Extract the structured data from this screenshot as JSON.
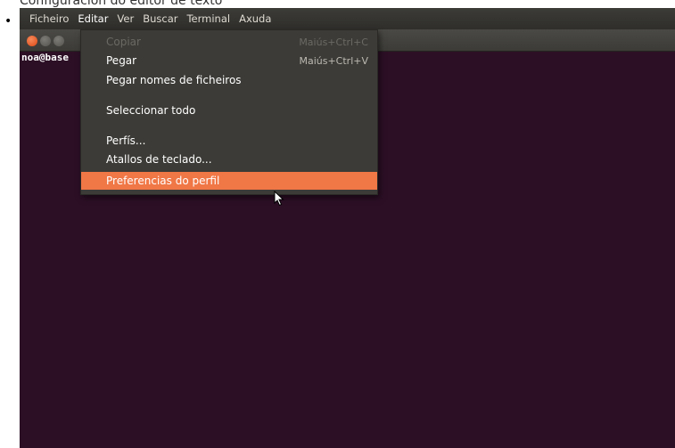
{
  "caption": "Configuración do editor de texto",
  "menubar": {
    "items": [
      "Ficheiro",
      "Editar",
      "Ver",
      "Buscar",
      "Terminal",
      "Axuda"
    ],
    "active": "Editar"
  },
  "terminal": {
    "prompt": "noa@base"
  },
  "edit_menu": {
    "items": [
      {
        "label": "Copiar",
        "shortcut": "Maiús+Ctrl+C",
        "enabled": false
      },
      {
        "label": "Pegar",
        "shortcut": "Maiús+Ctrl+V",
        "enabled": true
      },
      {
        "label": "Pegar nomes de ficheiros",
        "shortcut": "",
        "enabled": true
      },
      {
        "label": "Seleccionar todo",
        "shortcut": "",
        "enabled": true
      },
      {
        "label": "Perfís...",
        "shortcut": "",
        "enabled": true
      },
      {
        "label": "Atallos de teclado...",
        "shortcut": "",
        "enabled": true
      },
      {
        "label": "Preferencias do perfil",
        "shortcut": "",
        "enabled": true,
        "highlighted": true
      }
    ]
  },
  "colors": {
    "terminal_bg": "#2c0f25",
    "highlight": "#f07746",
    "menu_bg": "#3c3b37"
  }
}
